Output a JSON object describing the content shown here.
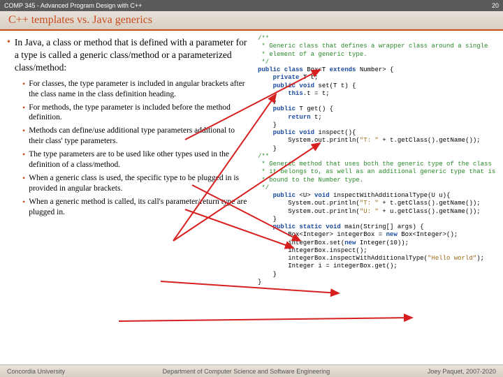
{
  "header": {
    "course": "COMP 345 - Advanced Program Design with C++",
    "page": "20",
    "title": "C++ templates vs. Java generics"
  },
  "main_text": "In Java, a class or method that is defined with a parameter for a type is called a generic class/method or a parameterized class/method:",
  "sub_bullets": [
    "For classes, the type parameter is included in angular brackets after the class name in the class definition heading.",
    "For methods, the type parameter is included before the method definition.",
    "Methods can define/use additional type parameters additional to their class' type parameters.",
    "The type parameters are to be used like other types used in the definition of a class/method.",
    "When a generic class is used, the specific type to be plugged in is provided in angular brackets.",
    "When a generic method is called, its call's parameter/return type are plugged in."
  ],
  "code": [
    {
      "t": "c",
      "s": "/**"
    },
    {
      "t": "c",
      "s": " * Generic class that defines a wrapper class around a single"
    },
    {
      "t": "c",
      "s": " * element of a generic type."
    },
    {
      "t": "c",
      "s": " */"
    },
    {
      "t": "h",
      "html": "<span class='c-blue'>public class</span> Box&lt;T <span class='c-blue'>extends</span> Number&gt; {"
    },
    {
      "t": "p",
      "s": ""
    },
    {
      "t": "h",
      "html": "    <span class='c-blue'>private</span> T t;"
    },
    {
      "t": "p",
      "s": ""
    },
    {
      "t": "h",
      "html": "    <span class='c-blue'>public void</span> set(T t) {"
    },
    {
      "t": "h",
      "html": "        <span class='c-blue'>this</span>.t = t;"
    },
    {
      "t": "p",
      "s": "    }"
    },
    {
      "t": "p",
      "s": ""
    },
    {
      "t": "h",
      "html": "    <span class='c-blue'>public</span> T get() {"
    },
    {
      "t": "h",
      "html": "        <span class='c-blue'>return</span> t;"
    },
    {
      "t": "p",
      "s": "    }"
    },
    {
      "t": "p",
      "s": ""
    },
    {
      "t": "h",
      "html": "    <span class='c-blue'>public void</span> inspect(){"
    },
    {
      "t": "h",
      "html": "        System.out.println(<span class='c-str'>\"T: \"</span> + t.getClass().getName());"
    },
    {
      "t": "p",
      "s": "    }"
    },
    {
      "t": "p",
      "s": ""
    },
    {
      "t": "c",
      "s": "/**"
    },
    {
      "t": "c",
      "s": " * Generic method that uses both the generic type of the class"
    },
    {
      "t": "c",
      "s": " * it belongs to, as well as an additional generic type that is"
    },
    {
      "t": "c",
      "s": " * bound to the Number type."
    },
    {
      "t": "c",
      "s": " */"
    },
    {
      "t": "h",
      "html": "    <span class='c-blue'>public</span> &lt;U&gt; <span class='c-blue'>void</span> inspectWithAdditionalType(U u){"
    },
    {
      "t": "h",
      "html": "        System.out.println(<span class='c-str'>\"T: \"</span> + t.getClass().getName());"
    },
    {
      "t": "h",
      "html": "        System.out.println(<span class='c-str'>\"U: \"</span> + u.getClass().getName());"
    },
    {
      "t": "p",
      "s": "    }"
    },
    {
      "t": "p",
      "s": ""
    },
    {
      "t": "h",
      "html": "    <span class='c-blue'>public static void</span> main(String[] args) {"
    },
    {
      "t": "h",
      "html": "        Box&lt;Integer&gt; integerBox = <span class='c-blue'>new</span> Box&lt;Integer&gt;();"
    },
    {
      "t": "h",
      "html": "        integerBox.set(<span class='c-blue'>new</span> Integer(10));"
    },
    {
      "t": "p",
      "s": "        integerBox.inspect();"
    },
    {
      "t": "h",
      "html": "        integerBox.inspectWithAdditionalType(<span class='c-str'>\"Hello world\"</span>);"
    },
    {
      "t": "p",
      "s": "        Integer i = integerBox.get();"
    },
    {
      "t": "p",
      "s": "    }"
    },
    {
      "t": "p",
      "s": "}"
    }
  ],
  "footer": {
    "left": "Concordia University",
    "center": "Department of Computer Science and Software Engineering",
    "right": "Joey Paquet, 2007-2020"
  }
}
